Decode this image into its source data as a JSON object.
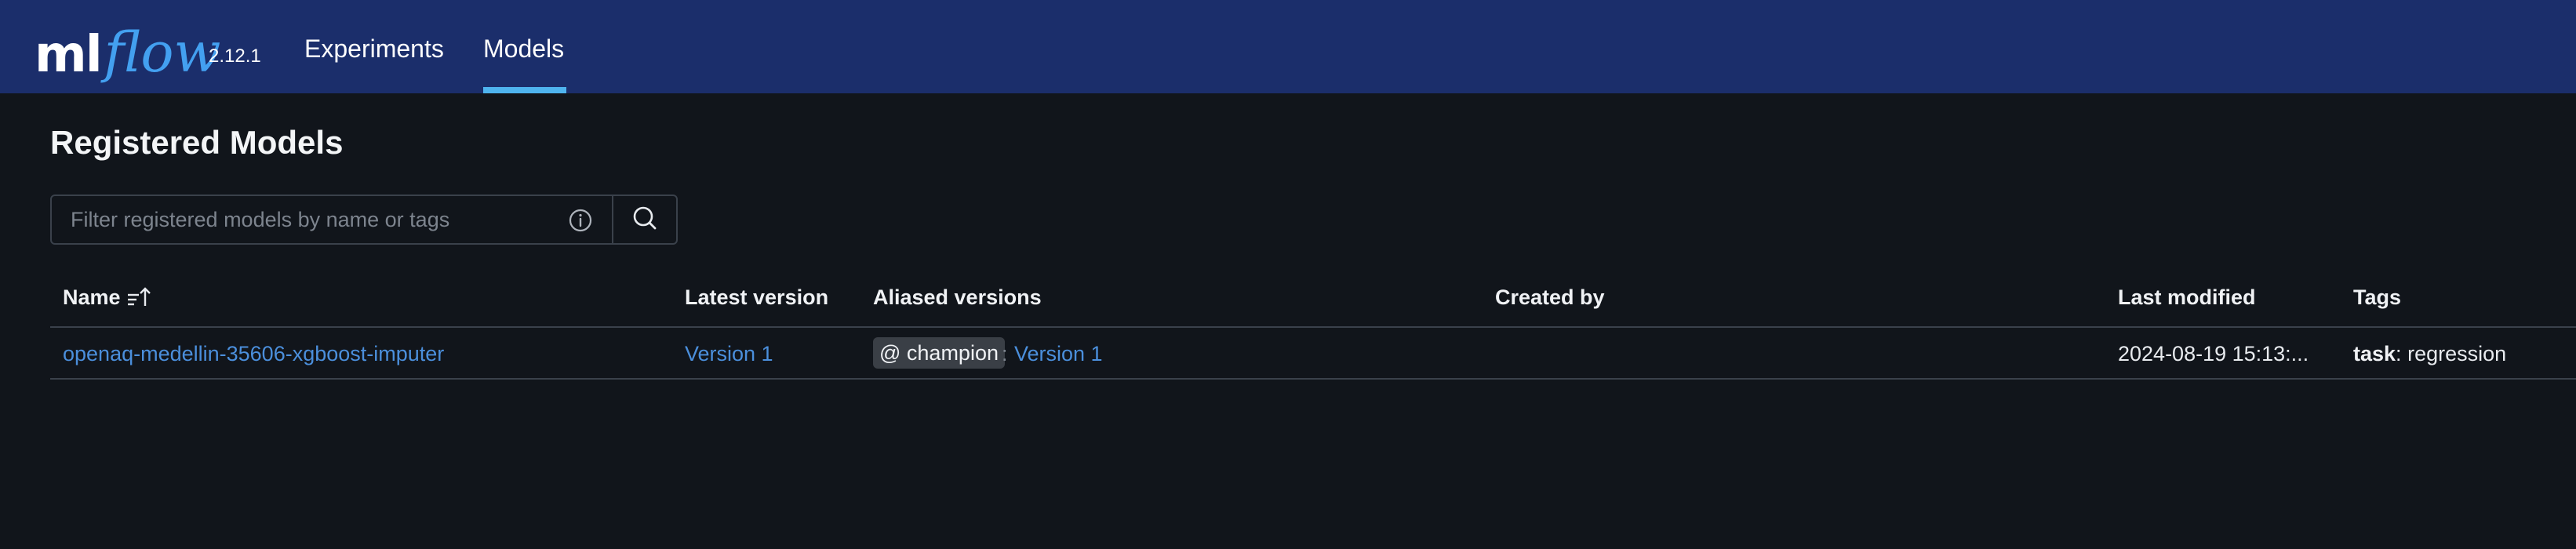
{
  "app": {
    "logo_primary": "ml",
    "logo_secondary": "flow",
    "version": "2.12.1"
  },
  "nav": {
    "items": [
      {
        "label": "Experiments",
        "active": false
      },
      {
        "label": "Models",
        "active": true
      }
    ]
  },
  "page": {
    "title": "Registered Models"
  },
  "search": {
    "placeholder": "Filter registered models by name or tags",
    "value": ""
  },
  "table": {
    "columns": [
      "Name",
      "Latest version",
      "Aliased versions",
      "Created by",
      "Last modified",
      "Tags"
    ],
    "sort_column": "Name",
    "rows": [
      {
        "name": "openaq-medellin-35606-xgboost-imputer",
        "latest_version": "Version 1",
        "alias": "@ champion",
        "alias_separator": ":",
        "alias_version": "Version 1",
        "created_by": "",
        "last_modified": "2024-08-19 15:13:...",
        "tag_key": "task",
        "tag_separator": ":",
        "tag_value": "regression"
      }
    ]
  },
  "colors": {
    "topbar": "#1b2e6b",
    "background": "#11151b",
    "link": "#4b8fdc",
    "logo_accent": "#43a0f0",
    "active_tab_underline": "#4fb4ef"
  }
}
